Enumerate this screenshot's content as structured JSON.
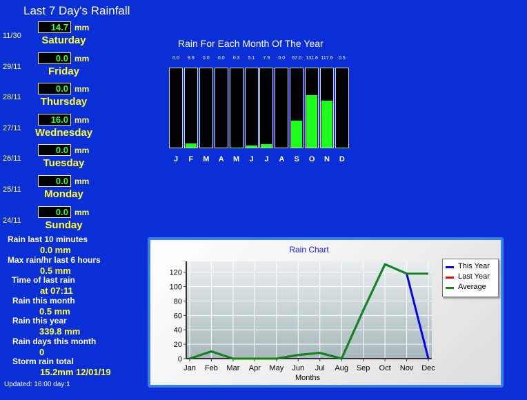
{
  "header": {
    "title": "Last 7 Day's Rainfall"
  },
  "days": [
    {
      "date": "11/30",
      "value": "14.7",
      "unit": "mm",
      "name": "Saturday"
    },
    {
      "date": "29/11",
      "value": "0.0",
      "unit": "mm",
      "name": "Friday"
    },
    {
      "date": "28/11",
      "value": "0.0",
      "unit": "mm",
      "name": "Thursday"
    },
    {
      "date": "27/11",
      "value": "16.0",
      "unit": "mm",
      "name": "Wednesday"
    },
    {
      "date": "26/11",
      "value": "0.0",
      "unit": "mm",
      "name": "Tuesday"
    },
    {
      "date": "25/11",
      "value": "0.0",
      "unit": "mm",
      "name": "Monday"
    },
    {
      "date": "24/11",
      "value": "0.0",
      "unit": "mm",
      "name": "Sunday"
    }
  ],
  "stats": [
    {
      "label": "Rain last 10 minutes",
      "value": "0.0 mm"
    },
    {
      "label": "Max rain/hr last 6 hours",
      "value": "0.5 mm"
    },
    {
      "label": "Time of last rain",
      "value": "at 07:11"
    },
    {
      "label": "Rain this month",
      "value": "0.5 mm"
    },
    {
      "label": "Rain this year",
      "value": "339.8 mm"
    },
    {
      "label": "Rain days this month",
      "value": "0"
    },
    {
      "label": "Storm rain total",
      "value": "15.2mm 12/01/19"
    }
  ],
  "footer": {
    "updated": "Updated: 16:00 day:1"
  },
  "chart_data": [
    {
      "type": "bar",
      "title": "Rain For Each Month Of The Year",
      "categories": [
        "J",
        "F",
        "M",
        "A",
        "M",
        "J",
        "J",
        "A",
        "S",
        "O",
        "N",
        "D"
      ],
      "values": [
        0.0,
        9.9,
        0.0,
        0.0,
        0.3,
        5.1,
        7.9,
        0.0,
        67.0,
        131.6,
        117.6,
        0.5
      ],
      "value_labels": [
        "0.0",
        "9.9",
        "0.0",
        "0.0",
        "0.3",
        "5.1",
        "7.9",
        "0.0",
        "67.0",
        "131.6",
        "117.6",
        "0.5"
      ],
      "ylim": [
        0,
        200
      ],
      "bar_color": "#1dff1d"
    },
    {
      "type": "line",
      "title": "Rain Chart",
      "xlabel": "Months",
      "categories": [
        "Jan",
        "Feb",
        "Mar",
        "Apr",
        "May",
        "Jun",
        "Jul",
        "Aug",
        "Sep",
        "Oct",
        "Nov",
        "Dec"
      ],
      "yticks": [
        0,
        20,
        40,
        60,
        80,
        100,
        120
      ],
      "ylim": [
        0,
        135
      ],
      "grid": true,
      "legend": "top-right",
      "series": [
        {
          "name": "This Year",
          "color": "#0000ff",
          "values": [
            0,
            10,
            0,
            0,
            0,
            5,
            8,
            0,
            67,
            131,
            118,
            0
          ]
        },
        {
          "name": "Last Year",
          "color": "#ff0000",
          "values": []
        },
        {
          "name": "Average",
          "color": "#118811",
          "values": [
            0,
            10,
            0,
            0,
            0,
            5,
            8,
            0,
            67,
            131,
            118,
            118
          ]
        }
      ]
    }
  ]
}
